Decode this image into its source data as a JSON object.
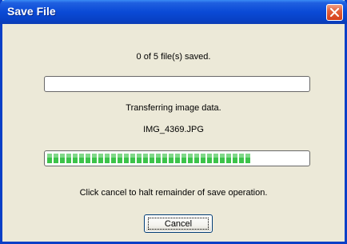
{
  "dialog": {
    "title": "Save File",
    "summary_text": "0 of 5 file(s) saved.",
    "overall_progress": 0,
    "status_text": "Transferring image data.",
    "current_file": "IMG_4369.JPG",
    "file_progress": 0.8,
    "hint_text": "Click cancel to halt remainder of save operation.",
    "cancel_label": "Cancel"
  },
  "colors": {
    "title_bar": "#0a4ad6",
    "progress_green": "#3cc34a",
    "close_red": "#d5401c"
  },
  "icons": {
    "close": "close-icon"
  }
}
